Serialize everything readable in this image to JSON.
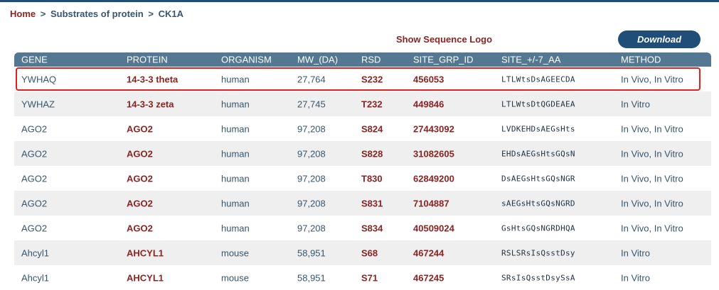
{
  "breadcrumb": {
    "home": "Home",
    "sep1": ">",
    "crumb1": "Substrates of protein",
    "sep2": ">",
    "crumb2": "CK1A"
  },
  "actions": {
    "show_logo": "Show Sequence Logo",
    "download": "Download"
  },
  "table": {
    "headers": [
      "GENE",
      "PROTEIN",
      "ORGANISM",
      "MW_(DA)",
      "RSD",
      "SITE_GRP_ID",
      "SITE_+/-7_AA",
      "METHOD"
    ],
    "rows": [
      {
        "gene": "YWHAQ",
        "protein": "14-3-3 theta",
        "organism": "human",
        "mw": "27,764",
        "rsd": "S232",
        "site_grp_id": "456053",
        "site_aa": "LTLWtsDsAGEECDA",
        "method": "In Vivo, In Vitro"
      },
      {
        "gene": "YWHAZ",
        "protein": "14-3-3 zeta",
        "organism": "human",
        "mw": "27,745",
        "rsd": "T232",
        "site_grp_id": "449846",
        "site_aa": "LTLWtsDtQGDEAEA",
        "method": "In Vitro"
      },
      {
        "gene": "AGO2",
        "protein": "AGO2",
        "organism": "human",
        "mw": "97,208",
        "rsd": "S824",
        "site_grp_id": "27443092",
        "site_aa": "LVDKEHDsAEGsHts",
        "method": "In Vivo, In Vitro"
      },
      {
        "gene": "AGO2",
        "protein": "AGO2",
        "organism": "human",
        "mw": "97,208",
        "rsd": "S828",
        "site_grp_id": "31082605",
        "site_aa": "EHDsAEGsHtsGQsN",
        "method": "In Vivo, In Vitro"
      },
      {
        "gene": "AGO2",
        "protein": "AGO2",
        "organism": "human",
        "mw": "97,208",
        "rsd": "T830",
        "site_grp_id": "62849200",
        "site_aa": "DsAEGsHtsGQsNGR",
        "method": "In Vivo, In Vitro"
      },
      {
        "gene": "AGO2",
        "protein": "AGO2",
        "organism": "human",
        "mw": "97,208",
        "rsd": "S831",
        "site_grp_id": "7104887",
        "site_aa": "sAEGsHtsGQsNGRD",
        "method": "In Vivo, In Vitro"
      },
      {
        "gene": "AGO2",
        "protein": "AGO2",
        "organism": "human",
        "mw": "97,208",
        "rsd": "S834",
        "site_grp_id": "40509024",
        "site_aa": "GsHtsGQsNGRDHQA",
        "method": "In Vivo, In Vitro"
      },
      {
        "gene": "Ahcyl1",
        "protein": "AHCYL1",
        "organism": "mouse",
        "mw": "58,951",
        "rsd": "S68",
        "site_grp_id": "467244",
        "site_aa": "RSLSRsIsQsstDsy",
        "method": "In Vitro"
      },
      {
        "gene": "Ahcyl1",
        "protein": "AHCYL1",
        "organism": "mouse",
        "mw": "58,951",
        "rsd": "S71",
        "site_grp_id": "467245",
        "site_aa": "SRsIsQsstDsySsA",
        "method": "In Vitro"
      }
    ]
  }
}
